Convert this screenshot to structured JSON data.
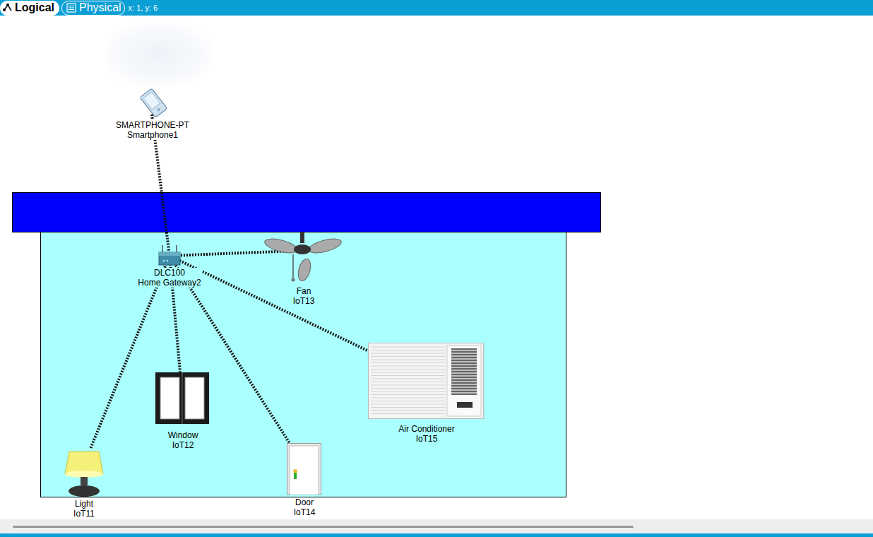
{
  "tabs": [
    {
      "label": "Logical",
      "selected": false
    },
    {
      "label": "Physical",
      "selected": true
    }
  ],
  "cursor": "x: 1, y: 6",
  "devices": [
    {
      "kind": "smartphone",
      "model": "SMARTPHONE-PT",
      "name": "Smartphone1"
    },
    {
      "kind": "gateway",
      "model": "DLC100",
      "name": "Home Gateway2"
    },
    {
      "kind": "fan",
      "model": "Fan",
      "name": "IoT13"
    },
    {
      "kind": "window",
      "model": "Window",
      "name": "IoT12"
    },
    {
      "kind": "door",
      "model": "Door",
      "name": "IoT14"
    },
    {
      "kind": "light",
      "model": "Light",
      "name": "IoT11"
    },
    {
      "kind": "aircon",
      "model": "Air Conditioner",
      "name": "IoT15"
    }
  ],
  "links": [
    {
      "from": "Smartphone1",
      "to": "Home Gateway2"
    },
    {
      "from": "Home Gateway2",
      "to": "IoT13"
    },
    {
      "from": "Home Gateway2",
      "to": "IoT12"
    },
    {
      "from": "Home Gateway2",
      "to": "IoT14"
    },
    {
      "from": "Home Gateway2",
      "to": "IoT11"
    },
    {
      "from": "Home Gateway2",
      "to": "IoT15"
    }
  ]
}
